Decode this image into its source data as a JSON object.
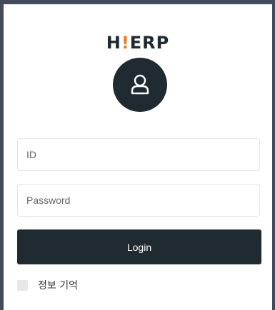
{
  "brand": {
    "prefix": "H",
    "accent": "!",
    "suffix": "ERP",
    "accent_color": "#f07a1a"
  },
  "avatar": {
    "icon": "user-icon"
  },
  "form": {
    "id_placeholder": "ID",
    "password_placeholder": "Password",
    "login_label": "Login",
    "remember_label": "정보 기억"
  }
}
